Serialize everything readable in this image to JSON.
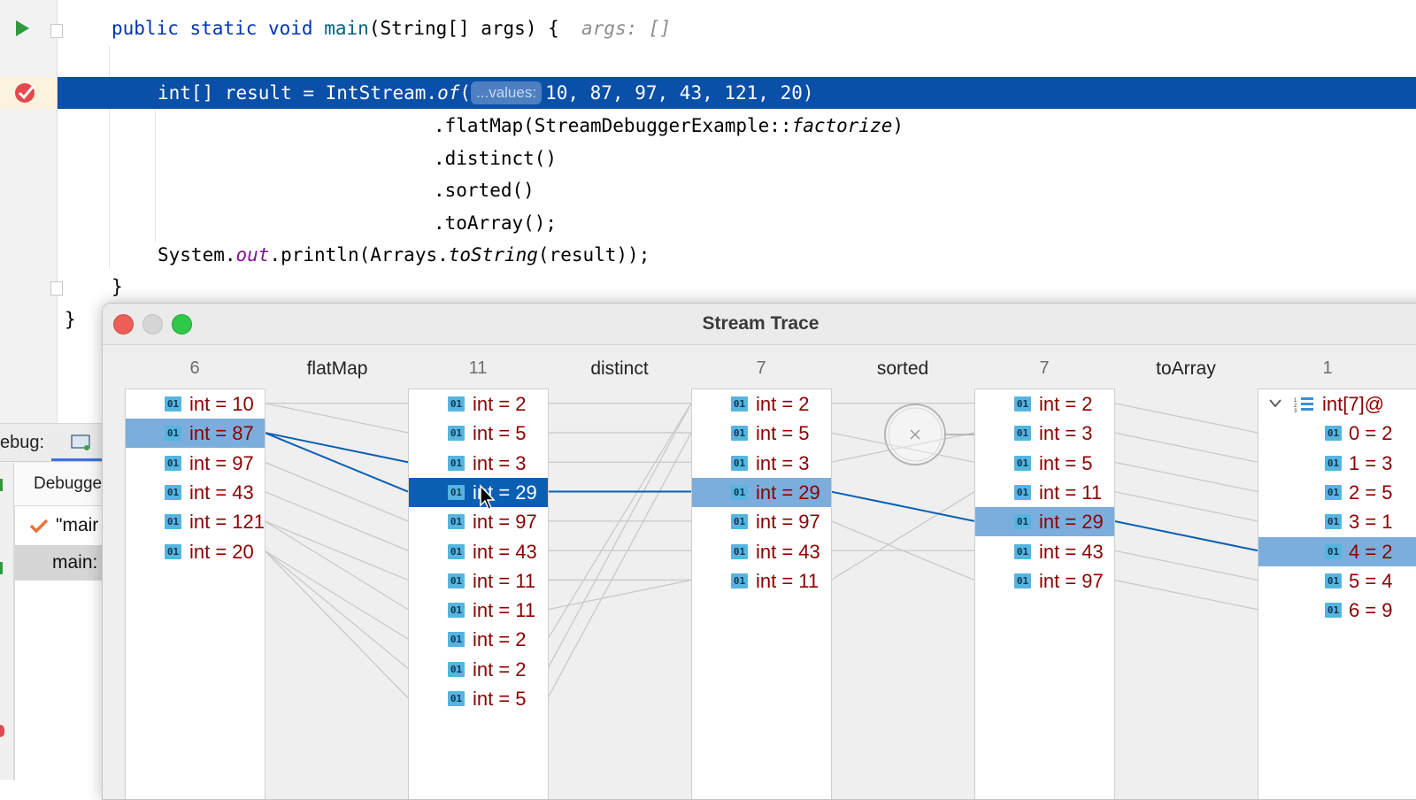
{
  "editor": {
    "main_signature": {
      "kw1": "public static void",
      "name": "main",
      "params": "(String[] args) {",
      "hint": "args: []"
    },
    "current_line": {
      "prefix": "int[] result = IntStream.",
      "method": "of",
      "paren": "(",
      "param_hint": "...values:",
      "args": "10, 87, 97, 43, 121, 20)"
    },
    "chain": {
      "flatmap_a": ".flatMap(StreamDebuggerExample::",
      "flatmap_b": "factorize",
      "flatmap_c": ")",
      "distinct": ".distinct()",
      "sorted": ".sorted()",
      "toarray": ".toArray();"
    },
    "println": {
      "a": "System.",
      "b": "out",
      "c": ".println(Arrays.",
      "d": "toString",
      "e": "(result));"
    },
    "close_method": "}",
    "close_class": "}"
  },
  "debug_panel": {
    "tab_label": "ebug:",
    "debugger_tab": "Debugge",
    "thread_label": "\"mair",
    "frame_label": "main:"
  },
  "trace": {
    "title": "Stream Trace",
    "ops": [
      "flatMap",
      "distinct",
      "sorted",
      "toArray"
    ],
    "columns": [
      {
        "count": "6",
        "items": [
          "int = 10",
          "int = 87",
          "int = 97",
          "int = 43",
          "int = 121",
          "int = 20"
        ],
        "selected": 1
      },
      {
        "count": "11",
        "items": [
          "int = 2",
          "int = 5",
          "int = 3",
          "int = 29",
          "int = 97",
          "int = 43",
          "int = 11",
          "int = 11",
          "int = 2",
          "int = 2",
          "int = 5"
        ],
        "current": 3
      },
      {
        "count": "7",
        "items": [
          "int = 2",
          "int = 5",
          "int = 3",
          "int = 29",
          "int = 97",
          "int = 43",
          "int = 11"
        ],
        "selected": 3
      },
      {
        "count": "7",
        "items": [
          "int = 2",
          "int = 3",
          "int = 5",
          "int = 11",
          "int = 29",
          "int = 43",
          "int = 97"
        ],
        "selected": 4
      },
      {
        "count": "1",
        "array_label": "int[7]@",
        "items": [
          "0 = 2",
          "1 = 3",
          "2 = 5",
          "3 = 1",
          "4 = 2",
          "5 = 4",
          "6 = 9"
        ],
        "selected": 4
      }
    ],
    "badge": "01"
  },
  "colors": {
    "current_line": "#0a4fa8",
    "selection": "#7baedc",
    "link_highlight": "#0a5fb3",
    "value_text": "#8b0000"
  }
}
